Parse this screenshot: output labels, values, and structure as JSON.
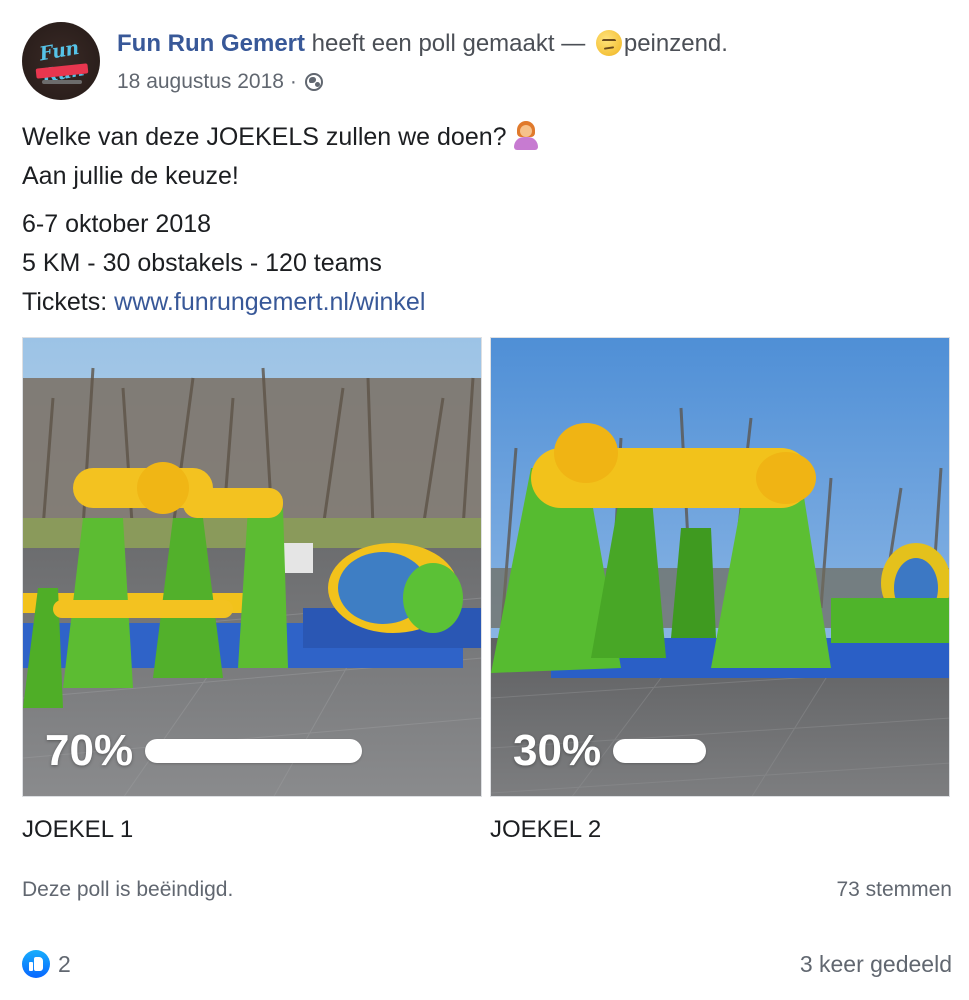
{
  "post": {
    "page_name": "Fun Run Gemert",
    "action_text": " heeft een poll gemaakt — ",
    "feeling": "peinzend.",
    "date": "18 augustus 2018",
    "separator": " · ",
    "privacy_icon": "globe-icon",
    "avatar_text": "Fun Run",
    "text": {
      "line1": "Welke van deze JOEKELS zullen we doen?",
      "line2": "Aan jullie de keuze!",
      "line3": "6-7 oktober 2018",
      "line4": "5 KM - 30 obstakels - 120 teams",
      "line5_prefix": "Tickets: ",
      "line5_link": "www.funrungemert.nl/winkel"
    }
  },
  "poll": {
    "options": [
      {
        "label": "JOEKEL 1",
        "percent_text": "70%",
        "percent": 70
      },
      {
        "label": "JOEKEL 2",
        "percent_text": "30%",
        "percent": 30
      }
    ],
    "status": "Deze poll is beëindigd.",
    "votes": "73 stemmen"
  },
  "reactions": {
    "icon": "like-icon",
    "count": "2",
    "shares": "3 keer gedeeld"
  },
  "colors": {
    "link": "#385898",
    "secondary_text": "#616770",
    "like_blue": "#0866ff"
  }
}
